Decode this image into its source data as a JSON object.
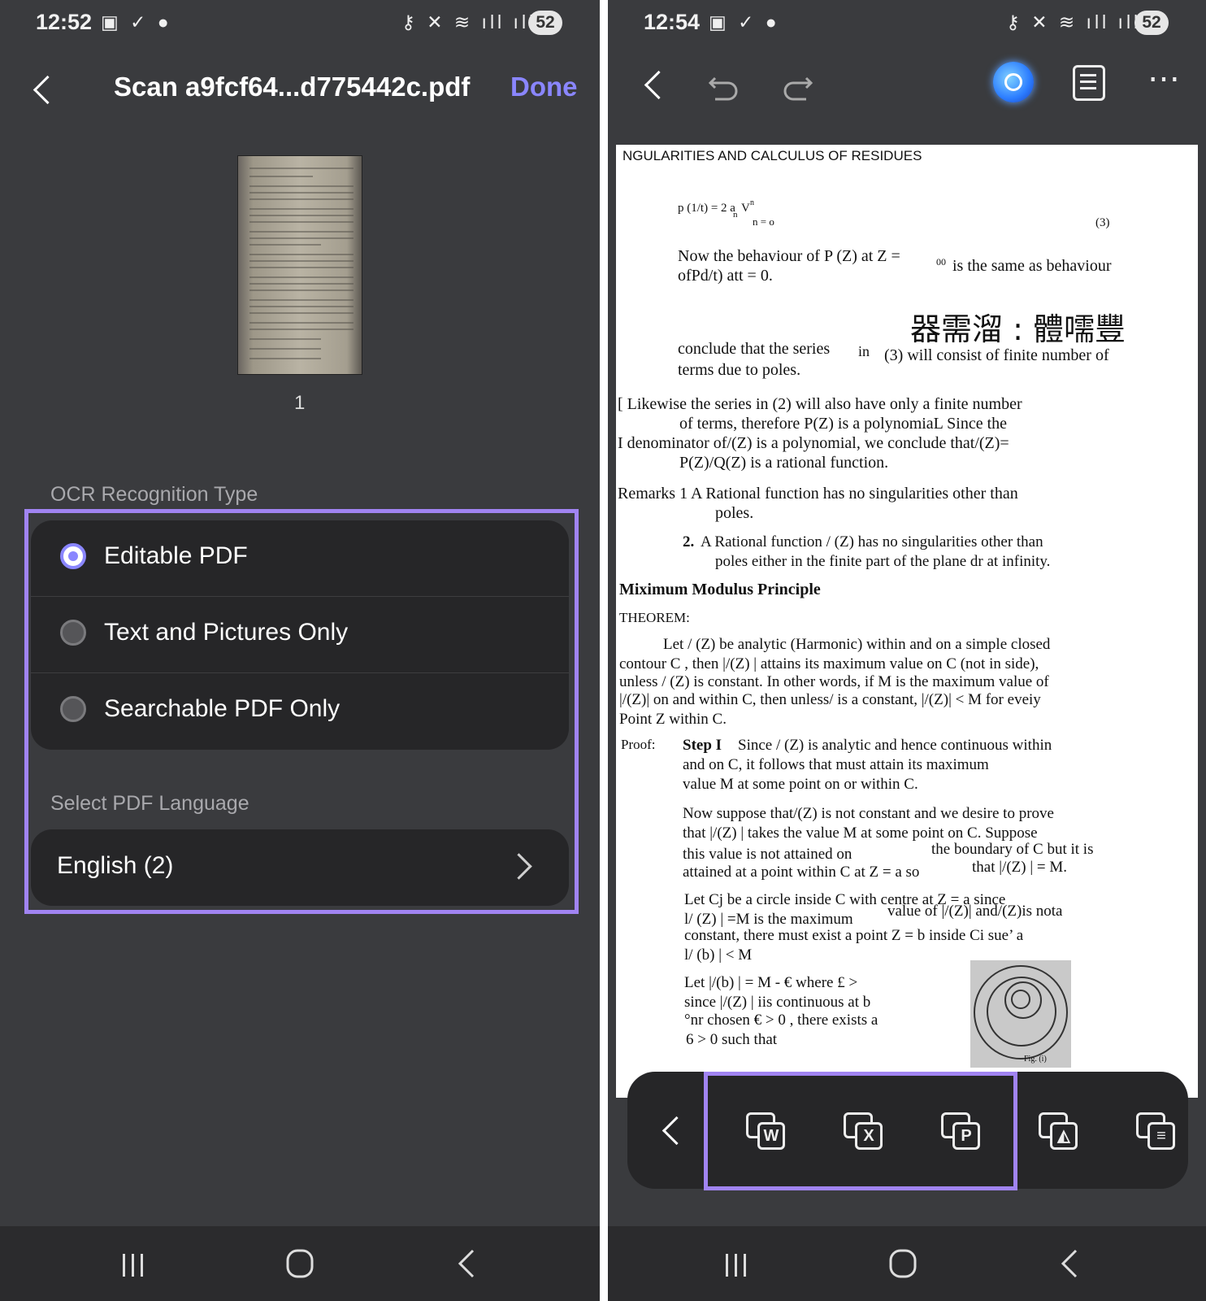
{
  "left_screen": {
    "status": {
      "time": "12:52",
      "battery": "52"
    },
    "header": {
      "title": "Scan a9fcf64...d775442c.pdf",
      "done_label": "Done"
    },
    "thumbnail": {
      "page_number": "1"
    },
    "ocr": {
      "section_label": "OCR Recognition Type",
      "options": [
        {
          "label": "Editable PDF",
          "selected": true
        },
        {
          "label": "Text and Pictures Only",
          "selected": false
        },
        {
          "label": "Searchable PDF Only",
          "selected": false
        }
      ]
    },
    "language": {
      "section_label": "Select PDF Language",
      "value": "English (2)"
    }
  },
  "right_screen": {
    "status": {
      "time": "12:54",
      "battery": "52"
    },
    "document": {
      "lines": [
        "NGULARITIES AND CALCULUS OF RESIDUES",
        "p (1/t) = 2 a",
        "n",
        "V",
        "n",
        "n = o",
        "(3)",
        "Now the behaviour of P (Z) at Z =",
        "00",
        "is the same as behaviour",
        "ofPd/t) att = 0.",
        "器需溜 : 體嚅豐",
        "conclude that the series",
        "in",
        "(3) will consist of finite number of",
        "terms due to poles.",
        "[ Likewise the series in (2) will also have only a finite number",
        "of terms, therefore P(Z) is a polynomiaL Since the",
        "I denominator of/(Z) is a polynomial, we conclude that/(Z)=",
        "P(Z)/Q(Z) is a rational function.",
        "Remarks 1 A Rational function has no singularities other than",
        "poles.",
        "2.",
        "A Rational function / (Z) has no singularities other than",
        "poles either in the finite part of the plane dr at infinity.",
        "Miximum Modulus Principle",
        "THEOREM:",
        "Let / (Z) be analytic (Harmonic) within and on a simple closed",
        "contour C , then |/(Z) | attains its maximum value on C (not in side),",
        "unless / (Z) is constant. In other words, if M is the maximum value of",
        "|/(Z)| on and within C, then unless/ is a constant, |/(Z)| < M for eveiy",
        "Point Z within C.",
        "Proof:",
        "Step I",
        "Since / (Z) is analytic and hence continuous within",
        "and on C, it follows that must attain its maximum",
        "value M at some point on or within C.",
        "Now suppose that/(Z) is not constant and we desire to prove",
        "that |/(Z) | takes the value M at some point on C. Suppose",
        "this value is not attained on",
        "the boundary of C but it is",
        "attained at a point within C at Z = a so",
        "that |/(Z) | = M.",
        "Let Cj be a circle inside C with centre at Z = a since",
        "l/ (Z) | =M is the maximum",
        "value of |/(Z)| and/(Z)is nota",
        "constant, there must exist a point Z = b inside Ci sue’ a",
        "l/ (b) | < M",
        "Let |/(b) | = M - € where £ >",
        "since |/(Z) | iis continuous at b",
        "°nr chosen € > 0 , there exists a",
        "6 > 0 such that",
        "Fig. (i)"
      ]
    },
    "bottom_toolbar": {
      "icons": [
        "convert-to-word-icon",
        "convert-to-excel-icon",
        "convert-to-ppt-icon",
        "convert-to-image-icon",
        "convert-to-text-icon"
      ],
      "letters": [
        "W",
        "X",
        "P",
        "",
        ""
      ]
    }
  },
  "colors": {
    "accent": "#8a86ff",
    "highlight": "#a184f2",
    "bg": "#3a3b3e",
    "card": "#262628"
  }
}
